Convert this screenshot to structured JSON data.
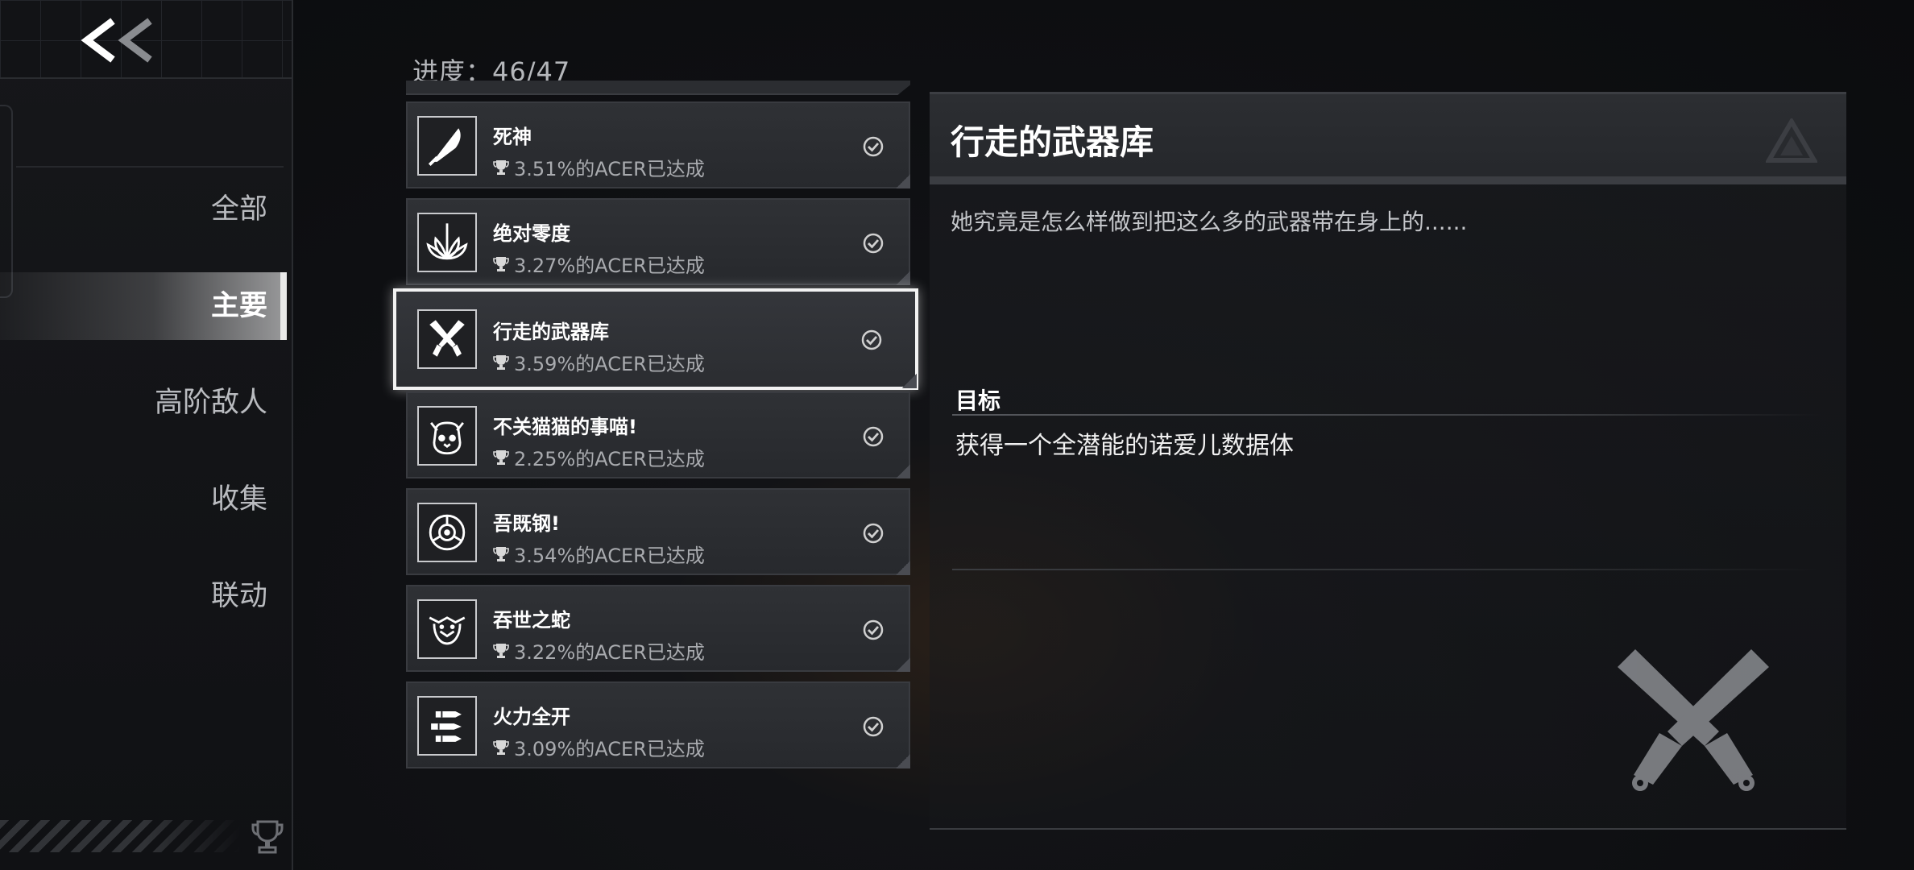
{
  "sidebar": {
    "back_icon": "double-chevron-left-icon",
    "items": [
      {
        "label": "全部",
        "active": false
      },
      {
        "label": "主要",
        "active": true
      },
      {
        "label": "高阶敌人",
        "active": false
      },
      {
        "label": "收集",
        "active": false
      },
      {
        "label": "联动",
        "active": false
      }
    ],
    "footer_icon": "trophy-icon"
  },
  "list": {
    "progress": "进度：46/47",
    "achievements": [
      {
        "title": "死神",
        "stat": "3.51%的ACER已达成",
        "icon": "scythe-icon",
        "completed": true
      },
      {
        "title": "绝对零度",
        "stat": "3.27%的ACER已达成",
        "icon": "ice-crystal-icon",
        "completed": true
      },
      {
        "title": "行走的武器库",
        "stat": "3.59%的ACER已达成",
        "icon": "crossed-pistols-icon",
        "completed": true,
        "selected": true
      },
      {
        "title": "不关猫猫的事喵!",
        "stat": "2.25%的ACER已达成",
        "icon": "cat-icon",
        "completed": true
      },
      {
        "title": "吾既钢!",
        "stat": "3.54%的ACER已达成",
        "icon": "steel-emblem-icon",
        "completed": true
      },
      {
        "title": "吞世之蛇",
        "stat": "3.22%的ACER已达成",
        "icon": "serpent-icon",
        "completed": true
      },
      {
        "title": "火力全开",
        "stat": "3.09%的ACER已达成",
        "icon": "bullets-icon",
        "completed": true
      }
    ]
  },
  "detail": {
    "title": "行走的武器库",
    "description": "她究竟是怎么样做到把这么多的武器带在身上的......",
    "objective_label": "目标",
    "objective_text": "获得一个全潜能的诺爱儿数据体",
    "emblem_icon": "crossed-pistols-icon",
    "header_logo_icon": "triangle-logo-icon"
  },
  "colors": {
    "background": "#0e0f12",
    "card": "#2f3135",
    "selected_border": "#f2f2f2",
    "text_primary": "#ffffff",
    "text_secondary": "#a9abaf"
  }
}
